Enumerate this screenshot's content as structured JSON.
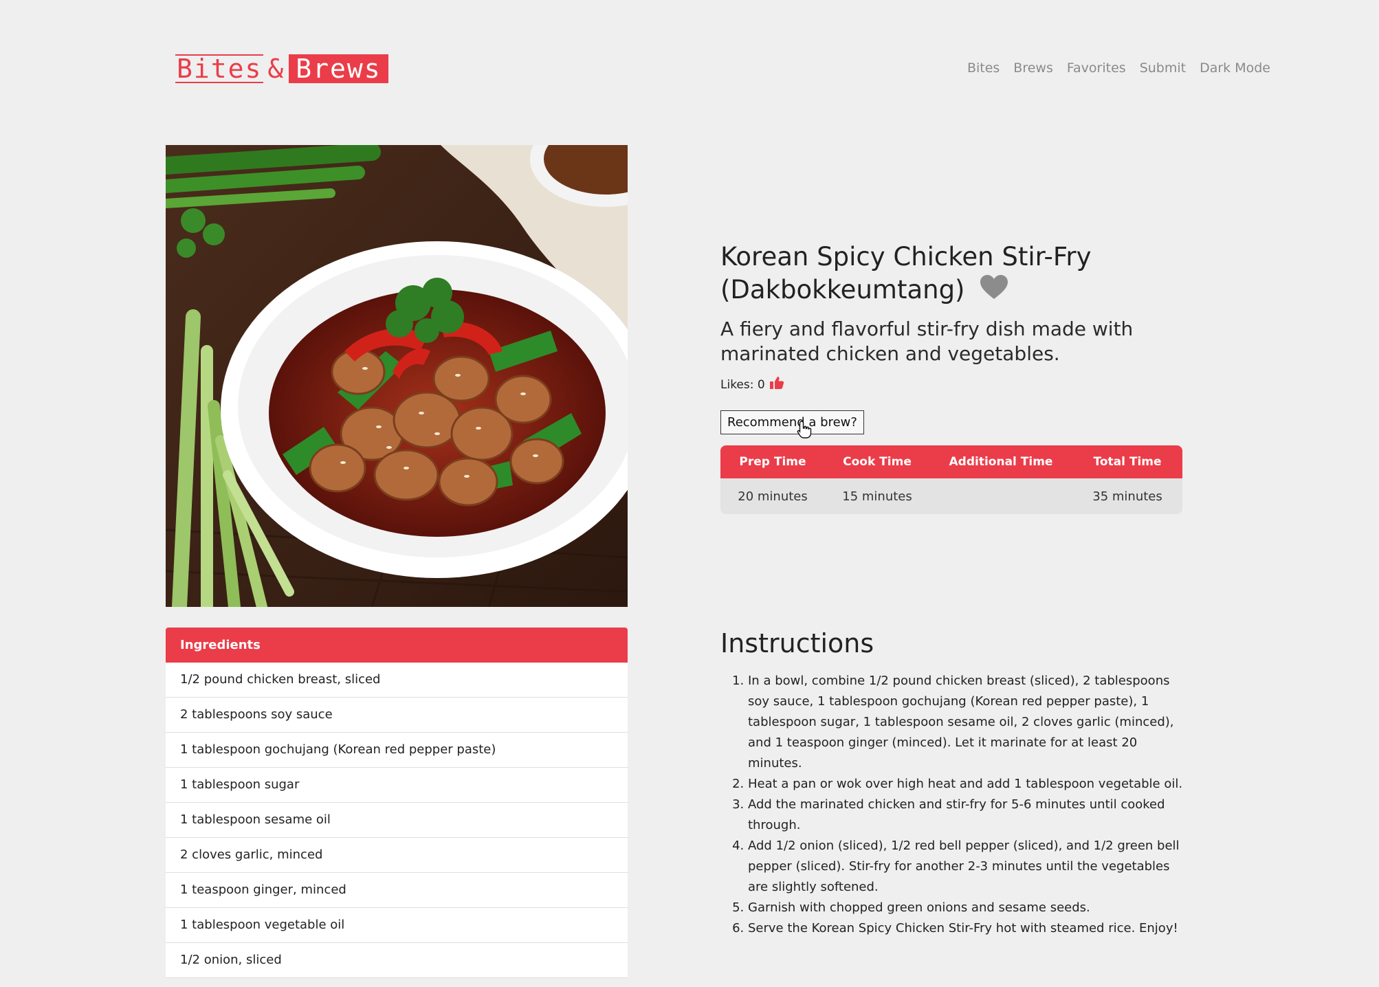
{
  "brand": {
    "bites": "Bites",
    "amp": "&",
    "brews": "Brews"
  },
  "nav": {
    "items": [
      "Bites",
      "Brews",
      "Favorites",
      "Submit",
      "Dark Mode"
    ]
  },
  "recipe": {
    "title": "Korean Spicy Chicken Stir-Fry (Dakbokkeumtang)",
    "description": "A fiery and flavorful stir-fry dish made with marinated chicken and vegetables.",
    "likes_label": "Likes: 0",
    "recommend_label": "Recommend a brew?",
    "times": {
      "headers": [
        "Prep Time",
        "Cook Time",
        "Additional Time",
        "Total Time"
      ],
      "values": [
        "20 minutes",
        "15 minutes",
        "",
        "35 minutes"
      ]
    }
  },
  "ingredients": {
    "heading": "Ingredients",
    "items": [
      "1/2 pound chicken breast, sliced",
      "2 tablespoons soy sauce",
      "1 tablespoon gochujang (Korean red pepper paste)",
      "1 tablespoon sugar",
      "1 tablespoon sesame oil",
      "2 cloves garlic, minced",
      "1 teaspoon ginger, minced",
      "1 tablespoon vegetable oil",
      "1/2 onion, sliced"
    ]
  },
  "instructions": {
    "heading": "Instructions",
    "steps": [
      "In a bowl, combine 1/2 pound chicken breast (sliced), 2 tablespoons soy sauce, 1 tablespoon gochujang (Korean red pepper paste), 1 tablespoon sugar, 1 tablespoon sesame oil, 2 cloves garlic (minced), and 1 teaspoon ginger (minced). Let it marinate for at least 20 minutes.",
      "Heat a pan or wok over high heat and add 1 tablespoon vegetable oil.",
      "Add the marinated chicken and stir-fry for 5-6 minutes until cooked through.",
      "Add 1/2 onion (sliced), 1/2 red bell pepper (sliced), and 1/2 green bell pepper (sliced). Stir-fry for another 2-3 minutes until the vegetables are slightly softened.",
      "Garnish with chopped green onions and sesame seeds.",
      "Serve the Korean Spicy Chicken Stir-Fry hot with steamed rice. Enjoy!"
    ]
  },
  "colors": {
    "accent": "#ea3d49",
    "background": "#efefef",
    "nav_text": "#8a8a8a",
    "heart": "#8c8c8c"
  },
  "icons": {
    "favorite": "heart-icon",
    "like": "thumbs-up-icon",
    "cursor": "hand-pointer-icon"
  }
}
